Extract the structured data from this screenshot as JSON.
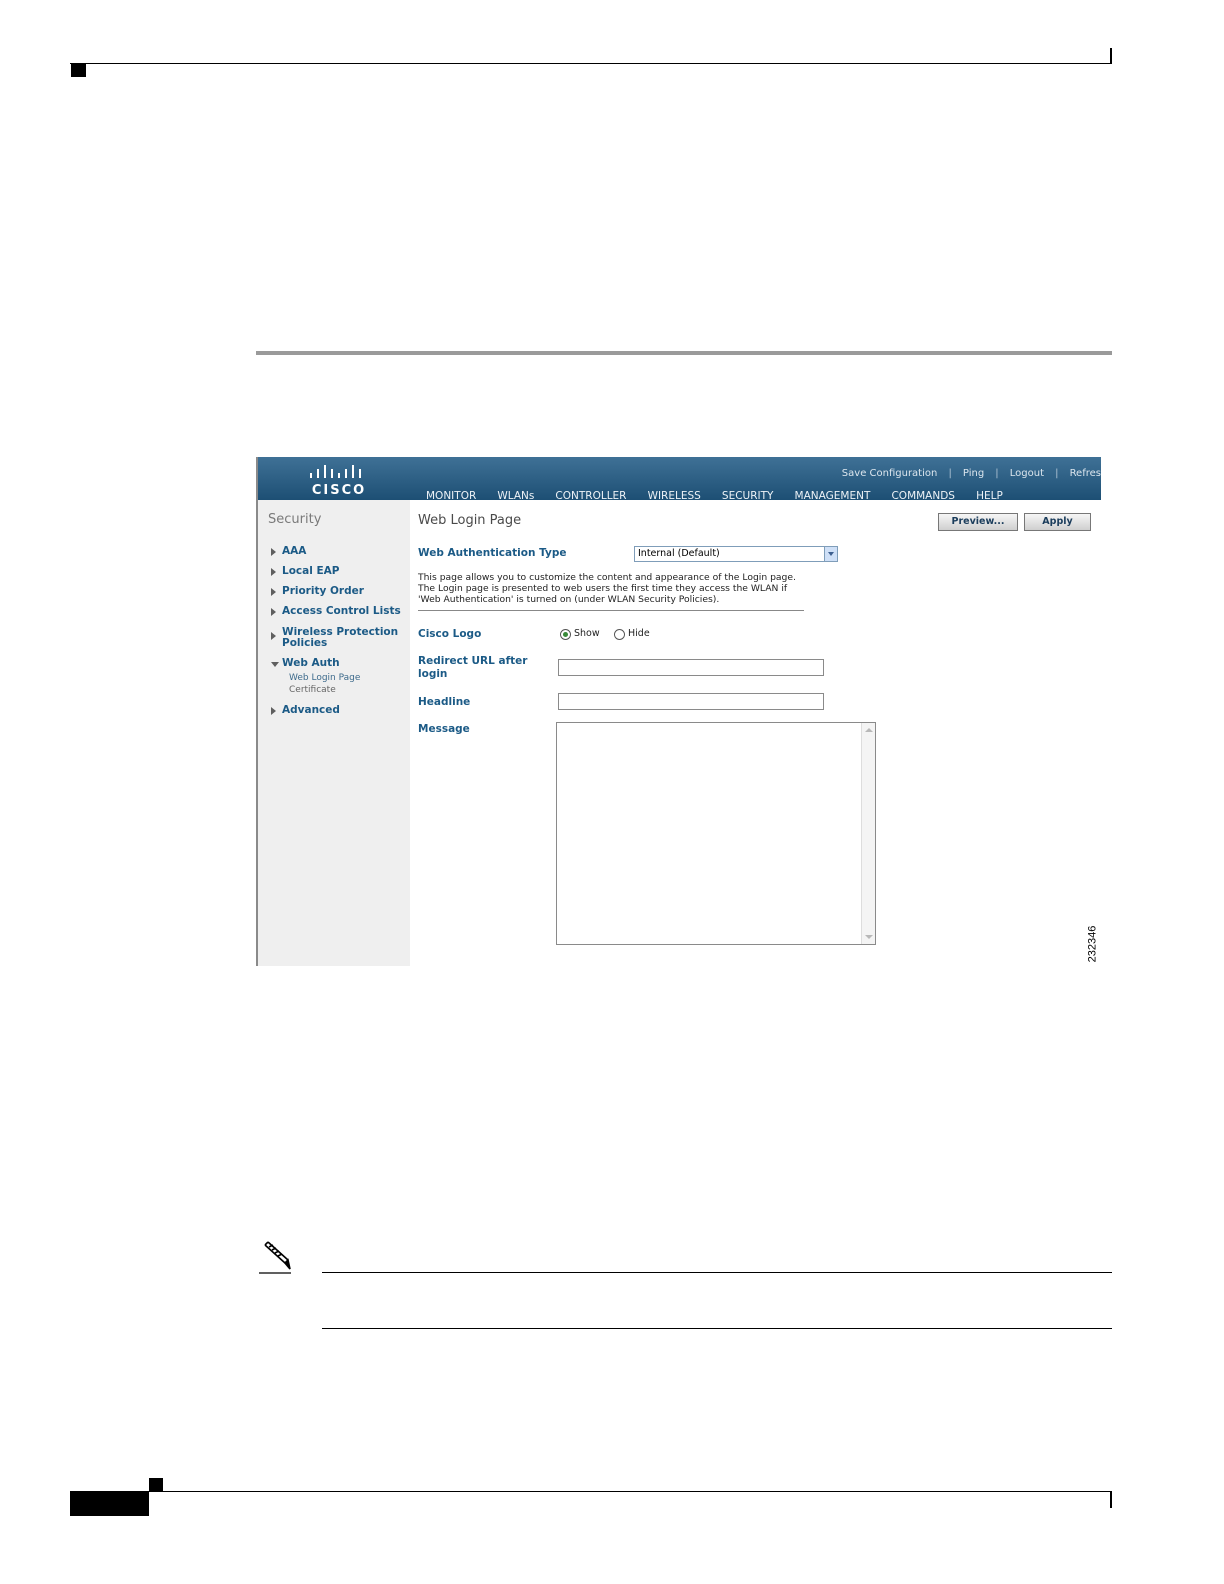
{
  "app": {
    "brand": "CISCO",
    "utility_links": [
      "Save Configuration",
      "Ping",
      "Logout",
      "Refres"
    ],
    "nav": [
      "MONITOR",
      "WLANs",
      "CONTROLLER",
      "WIRELESS",
      "SECURITY",
      "MANAGEMENT",
      "COMMANDS",
      "HELP"
    ],
    "nav_active": "SECURITY",
    "accent": "#f0a000",
    "header_color": "#2a5c82"
  },
  "sidebar": {
    "title": "Security",
    "items": [
      {
        "label": "AAA"
      },
      {
        "label": "Local EAP"
      },
      {
        "label": "Priority Order"
      },
      {
        "label": "Access Control Lists"
      },
      {
        "label": "Wireless Protection Policies"
      },
      {
        "label": "Web Auth",
        "expanded": true,
        "children": [
          "Web Login Page",
          "Certificate"
        ]
      },
      {
        "label": "Advanced"
      }
    ]
  },
  "page": {
    "title": "Web Login Page",
    "buttons": {
      "preview": "Preview...",
      "apply": "Apply"
    },
    "auth_type": {
      "label": "Web Authentication Type",
      "value": "Internal (Default)"
    },
    "description": "This page allows you to customize the content and appearance of the Login page. The Login page is presented to web users the first time they access the WLAN if 'Web Authentication' is turned on (under WLAN Security Policies).",
    "cisco_logo": {
      "label": "Cisco Logo",
      "options": [
        "Show",
        "Hide"
      ],
      "selected": "Show"
    },
    "redirect_url": {
      "label": "Redirect URL after login",
      "value": ""
    },
    "headline": {
      "label": "Headline",
      "value": ""
    },
    "message": {
      "label": "Message",
      "value": ""
    }
  },
  "figure_number": "232346"
}
